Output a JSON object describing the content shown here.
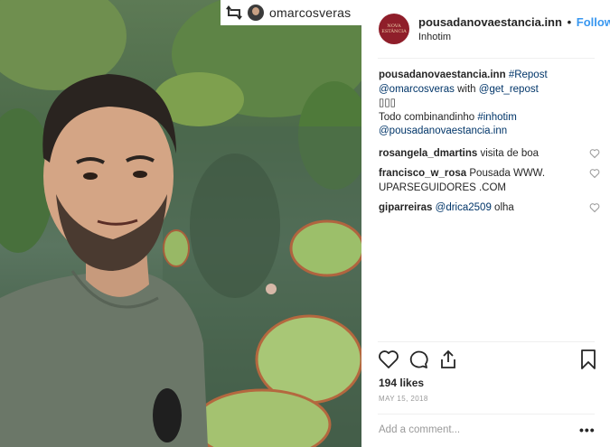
{
  "photo": {
    "repost_account": "omarcosveras"
  },
  "post": {
    "username": "pousadanovaestancia.inn",
    "separator": "•",
    "follow_label": "Follow",
    "location": "Inhotim",
    "avatar_text": "NOVA ESTÂNCIA"
  },
  "caption": {
    "username": "pousadanovaestancia.inn",
    "repost_tag": "#Repost",
    "mention_user": "@omarcosveras",
    "with_word": "with",
    "mention_app": "@get_repost",
    "boxes": "▯▯▯",
    "text": "Todo combinandinho",
    "hashtag": "#inhotim",
    "mention_inn": "@pousadanovaestancia.inn"
  },
  "comments": [
    {
      "username": "rosangela_dmartins",
      "text": "visita de boa"
    },
    {
      "username": "francisco_w_rosa",
      "text": "Pousada WWW. UPARSEGUIDORES .COM"
    },
    {
      "username": "giparreiras",
      "mention": "@drica2509",
      "text": "olha"
    }
  ],
  "stats": {
    "likes": "194 likes",
    "date": "MAY 15, 2018"
  },
  "composer": {
    "placeholder": "Add a comment...",
    "more_label": "•••"
  },
  "colors": {
    "link": "#003569",
    "follow": "#3897f0",
    "avatar_bg": "#8f1e2a"
  },
  "icons": [
    "repost-icon",
    "heart-icon",
    "comment-icon",
    "share-icon",
    "bookmark-icon",
    "small-heart-icon"
  ]
}
